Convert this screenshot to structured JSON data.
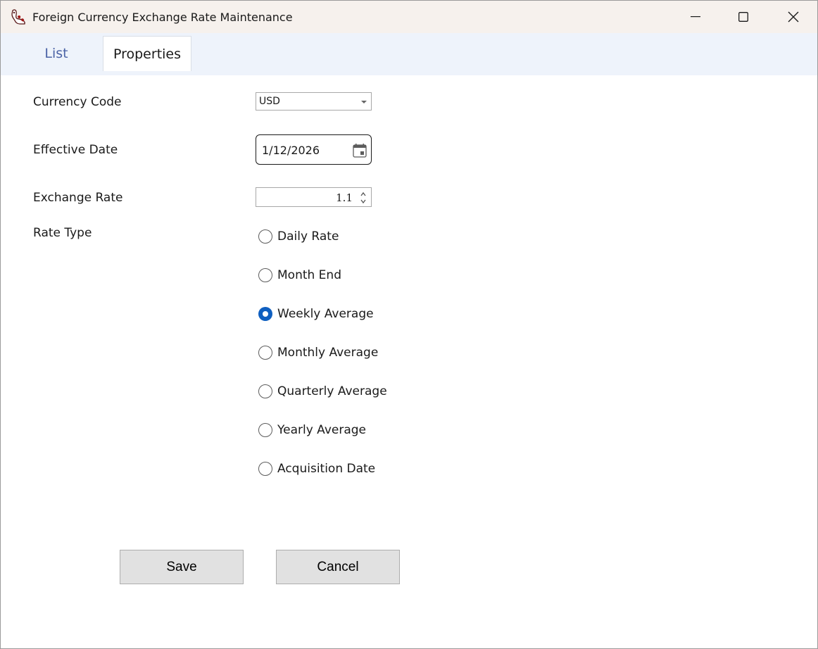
{
  "window": {
    "title": "Foreign Currency Exchange Rate Maintenance"
  },
  "tabs": [
    {
      "label": "List",
      "selected": false
    },
    {
      "label": "Properties",
      "selected": true
    }
  ],
  "form": {
    "currency_code": {
      "label": "Currency Code",
      "value": "USD"
    },
    "effective_date": {
      "label": "Effective Date",
      "value": "1/12/2026"
    },
    "exchange_rate": {
      "label": "Exchange Rate",
      "value": "1.1"
    },
    "rate_type": {
      "label": "Rate Type",
      "options": [
        {
          "label": "Daily Rate",
          "checked": false
        },
        {
          "label": "Month End",
          "checked": false
        },
        {
          "label": "Weekly Average",
          "checked": true
        },
        {
          "label": "Monthly Average",
          "checked": false
        },
        {
          "label": "Quarterly Average",
          "checked": false
        },
        {
          "label": "Yearly Average",
          "checked": false
        },
        {
          "label": "Acquisition Date",
          "checked": false
        }
      ]
    }
  },
  "buttons": {
    "save_label": "Save",
    "cancel_label": "Cancel"
  },
  "colors": {
    "accent": "#0f5fc0",
    "tab_inactive_text": "#4b63a6",
    "titlebar_bg": "#f6f1ed",
    "tabstrip_bg": "#eef3fb",
    "button_bg": "#e1e1e1"
  },
  "icons": {
    "app": "app-logo-icon",
    "minimize": "minimize-icon",
    "maximize": "maximize-icon",
    "close": "close-icon",
    "calendar": "calendar-icon",
    "dropdown": "chevron-down-icon"
  }
}
